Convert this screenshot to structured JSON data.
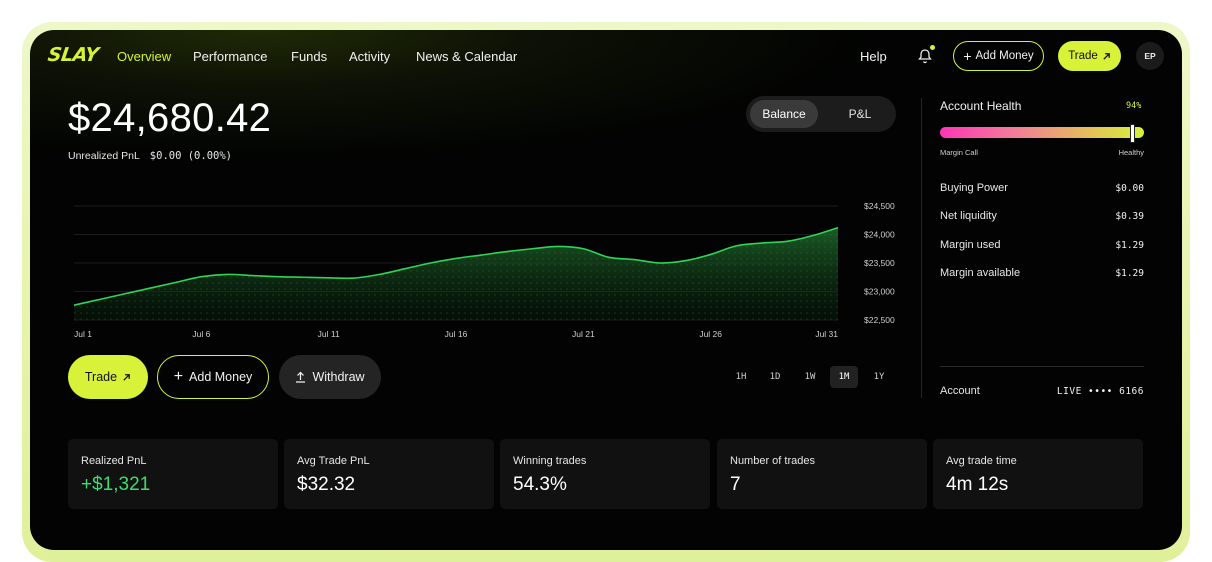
{
  "nav": {
    "logo": "SLAY",
    "items": [
      "Overview",
      "Performance",
      "Funds",
      "Activity",
      "News & Calendar"
    ],
    "help": "Help",
    "add_money": "Add Money",
    "trade": "Trade",
    "avatar": "EP"
  },
  "balance": {
    "amount": "$24,680.42",
    "unrealized_label": "Unrealized PnL",
    "unrealized_value": "$0.00",
    "unrealized_pct": "(0.00%)"
  },
  "toggle": {
    "selected": "Balance",
    "other": "P&L"
  },
  "chart_data": {
    "type": "area",
    "x": [
      "Jul 1",
      "Jul 2",
      "Jul 3",
      "Jul 4",
      "Jul 5",
      "Jul 6",
      "Jul 7",
      "Jul 8",
      "Jul 9",
      "Jul 10",
      "Jul 11",
      "Jul 12",
      "Jul 13",
      "Jul 14",
      "Jul 15",
      "Jul 16",
      "Jul 17",
      "Jul 18",
      "Jul 19",
      "Jul 20",
      "Jul 21",
      "Jul 22",
      "Jul 23",
      "Jul 24",
      "Jul 25",
      "Jul 26",
      "Jul 27",
      "Jul 28",
      "Jul 29",
      "Jul 30",
      "Jul 31"
    ],
    "series": [
      {
        "values": [
          22760,
          22860,
          22960,
          23060,
          23160,
          23260,
          23300,
          23280,
          23260,
          23250,
          23240,
          23235,
          23300,
          23400,
          23500,
          23580,
          23640,
          23700,
          23750,
          23790,
          23750,
          23600,
          23560,
          23500,
          23540,
          23650,
          23800,
          23850,
          23880,
          23980,
          24120
        ]
      }
    ],
    "x_tick_labels": [
      "Jul 1",
      "Jul 6",
      "Jul 11",
      "Jul 16",
      "Jul 21",
      "Jul 26",
      "Jul 31"
    ],
    "y_tick_labels": [
      "$24,500",
      "$24,000",
      "$23,500",
      "$23,000",
      "$22,500"
    ],
    "ylim": [
      22500,
      24500
    ],
    "grid": true,
    "color": "#2fd35a"
  },
  "actions": {
    "trade": "Trade",
    "add_money": "Add Money",
    "withdraw": "Withdraw"
  },
  "timeframes": {
    "options": [
      "1H",
      "1D",
      "1W",
      "1M",
      "1Y"
    ],
    "selected": "1M"
  },
  "health": {
    "title": "Account Health",
    "percent_label": "94%",
    "level": 0.94,
    "left_label": "Margin Call",
    "right_label": "Healthy"
  },
  "stats": [
    {
      "label": "Buying Power",
      "value": "$0.00"
    },
    {
      "label": "Net liquidity",
      "value": "$0.39"
    },
    {
      "label": "Margin used",
      "value": "$1.29"
    },
    {
      "label": "Margin available",
      "value": "$1.29"
    }
  ],
  "account": {
    "label": "Account",
    "value": "LIVE •••• 6166"
  },
  "cards": [
    {
      "label": "Realized PnL",
      "value": "+$1,321"
    },
    {
      "label": "Avg Trade PnL",
      "value": "$32.32"
    },
    {
      "label": "Winning trades",
      "value": "54.3%"
    },
    {
      "label": "Number of trades",
      "value": "7"
    },
    {
      "label": "Avg trade time",
      "value": "4m 12s"
    }
  ],
  "colors": {
    "accent": "#d7f238",
    "positive": "#3fdc6d",
    "background": "#020302"
  }
}
